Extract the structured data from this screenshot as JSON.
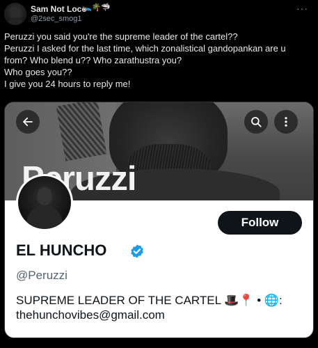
{
  "tweet": {
    "author_name": "Sam Not Loco",
    "author_emojis": "🛌🌴🦈",
    "author_handle": "@2sec_smog1",
    "more_icon": "more-dots-icon",
    "lines": [
      "Peruzzi you said you're the supreme leader of the cartel??",
      "Peruzzi I asked for the last time, which zonalistical gandopankan are u",
      "from? Who blend u?? Who zarathustra you?",
      "Who goes you??",
      "I give you 24 hours to reply me!"
    ]
  },
  "card": {
    "banner_text": "Peruzzi",
    "back_icon": "back-arrow-icon",
    "search_icon": "search-icon",
    "more_icon": "more-vertical-icon",
    "follow_label": "Follow",
    "display_name": "EL HUNCHO",
    "verified_icon": "verified-badge-icon",
    "handle": "@Peruzzi",
    "bio_line1": "SUPREME LEADER OF THE CARTEL 🎩📍 • 🌐:",
    "bio_line2": "thehunchovibes@gmail.com"
  },
  "colors": {
    "background": "#000000",
    "text_primary_dark": "#e7e9ea",
    "text_secondary_dark": "#8b98a5",
    "card_bg": "#ffffff",
    "text_primary_light": "#0f1419",
    "text_secondary_light": "#536471",
    "follow_button": "#0f1419",
    "verified_blue": "#1d9bf0"
  }
}
